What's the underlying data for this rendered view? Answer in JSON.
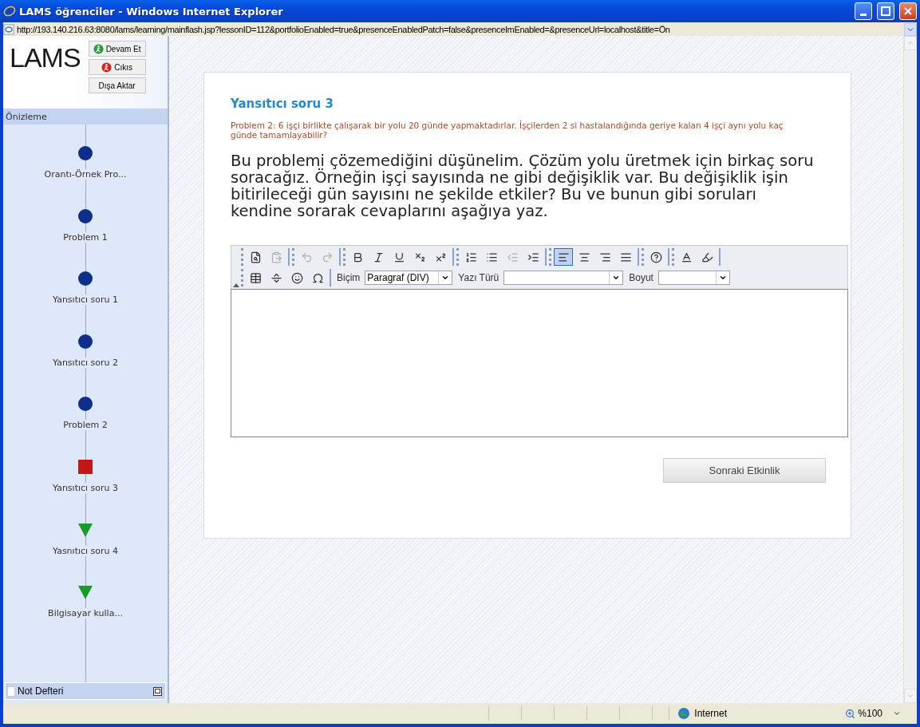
{
  "window": {
    "title": "LAMS öğrenciler - Windows Internet Explorer"
  },
  "address_bar": {
    "url": "http://193.140.216.63:8080/lams/learning/mainflash.jsp?lessonID=112&portfolioEnabled=true&presenceEnabledPatch=false&presenceImEnabled=&presenceUrl=localhost&title=Ön"
  },
  "sidebar": {
    "logo": "LAMS",
    "buttons": [
      {
        "label": "Devam Et",
        "kind": "go"
      },
      {
        "label": "Cıkıs",
        "kind": "exit"
      },
      {
        "label": "Dışa Aktar",
        "kind": "plain"
      }
    ],
    "header": "Önizleme",
    "activities": [
      {
        "label": "Orantı-Örnek Pro...",
        "kind": "done"
      },
      {
        "label": "Problem 1",
        "kind": "done"
      },
      {
        "label": "Yansıtıcı soru 1",
        "kind": "done"
      },
      {
        "label": "Yansıtıcı soru 2",
        "kind": "done"
      },
      {
        "label": "Problem 2",
        "kind": "done"
      },
      {
        "label": "Yansıtıcı soru 3",
        "kind": "current"
      },
      {
        "label": "Yasnıtıcı soru 4",
        "kind": "todo"
      },
      {
        "label": "Bilgisayar kulla...",
        "kind": "todo"
      }
    ],
    "notebook": "Not Defteri"
  },
  "content": {
    "title": "Yansıtıcı soru 3",
    "problem": "Problem 2: 6 işçi birlikte çalışarak bir yolu 20 günde yapmaktadırlar. İşçilerden 2 si hastalandığında geriye kalan 4 işçi aynı yolu kaç günde tamamlayabilir?",
    "question": "Bu problemi çözemediğini düşünelim. Çözüm yolu üretmek için birkaç soru soracağız. Örneğin işçi sayısında ne gibi değişiklik var. Bu değişiklik işin bitirileceği gün sayısını ne şekilde etkiler? Bu ve bunun gibi soruları kendine sorarak cevaplarını aşağıya yaz.",
    "editor": {
      "toolbar_1": [
        [
          {
            "kind": "preview",
            "disabled": false
          },
          {
            "kind": "paste",
            "disabled": true
          }
        ],
        [
          {
            "kind": "undo",
            "disabled": true
          },
          {
            "kind": "redo",
            "disabled": true
          }
        ],
        [
          {
            "kind": "bold",
            "disabled": false
          },
          {
            "kind": "italic",
            "disabled": false
          },
          {
            "kind": "underline",
            "disabled": false
          },
          {
            "kind": "subscript",
            "disabled": false
          },
          {
            "kind": "superscript",
            "disabled": false
          }
        ],
        [
          {
            "kind": "ordered-list",
            "disabled": false
          },
          {
            "kind": "bullet-list",
            "disabled": false
          },
          {
            "kind": "outdent",
            "disabled": true
          },
          {
            "kind": "indent",
            "disabled": false
          }
        ],
        [
          {
            "kind": "align-left",
            "disabled": false,
            "selected": true
          },
          {
            "kind": "align-center",
            "disabled": false,
            "selected": false
          },
          {
            "kind": "align-right",
            "disabled": false,
            "selected": false
          },
          {
            "kind": "align-justify",
            "disabled": false,
            "selected": false
          }
        ],
        [
          {
            "kind": "help",
            "disabled": false
          }
        ],
        [
          {
            "kind": "text-color",
            "disabled": false
          },
          {
            "kind": "highlight",
            "disabled": false
          }
        ]
      ],
      "toolbar_2": [
        [
          {
            "kind": "table",
            "disabled": false
          },
          {
            "kind": "rule",
            "disabled": false
          },
          {
            "kind": "smiley",
            "disabled": false
          },
          {
            "kind": "special-char",
            "disabled": false
          }
        ]
      ],
      "selects": [
        {
          "label": "Biçim",
          "value": "Paragraf (DIV)"
        },
        {
          "label": "Yazı Türü"
        },
        {
          "label": "Boyut"
        }
      ]
    },
    "next_button": "Sonraki Etkinlik"
  },
  "status_bar": {
    "zone": "Internet",
    "zoom": "%100"
  }
}
